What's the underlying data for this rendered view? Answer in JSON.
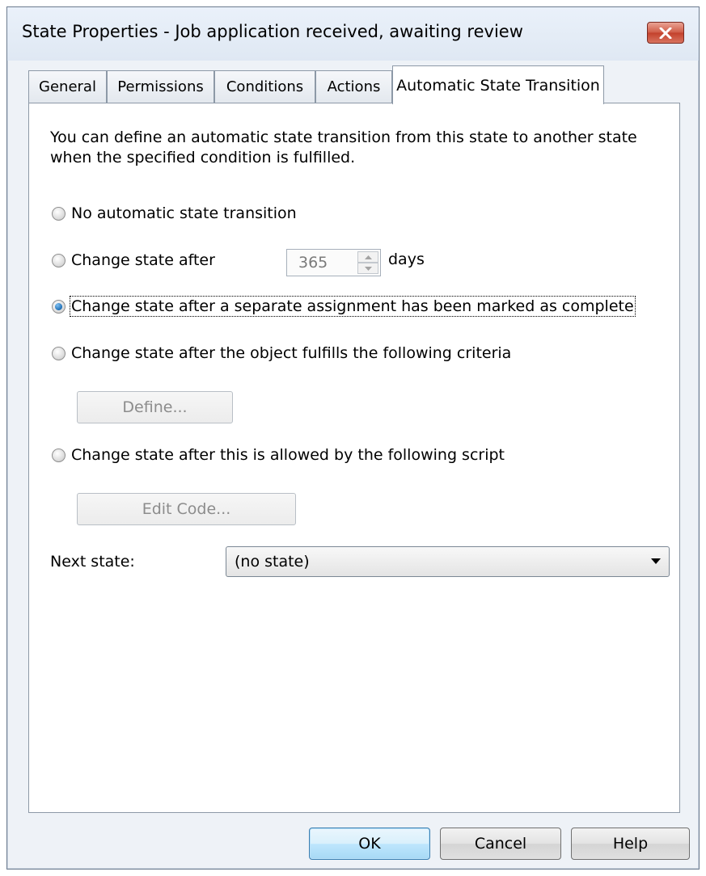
{
  "window": {
    "title": "State Properties - Job application received, awaiting review"
  },
  "tabs": [
    {
      "label": "General"
    },
    {
      "label": "Permissions"
    },
    {
      "label": "Conditions"
    },
    {
      "label": "Actions"
    },
    {
      "label": "Automatic State Transition",
      "active": true
    }
  ],
  "panel": {
    "intro": "You can define an automatic state transition from this state to another state when the specified condition is fulfilled.",
    "options": [
      {
        "label": "No automatic state transition",
        "checked": false
      },
      {
        "label": "Change state after",
        "checked": false
      },
      {
        "label": "Change state after a separate assignment has been marked as complete",
        "checked": true
      },
      {
        "label": "Change state after the object fulfills the following criteria",
        "checked": false
      },
      {
        "label": "Change state after this is allowed by the following script",
        "checked": false
      }
    ],
    "days_value": "365",
    "days_unit": "days",
    "define_button": "Define...",
    "edit_code_button": "Edit Code...",
    "next_state_label": "Next state:",
    "next_state_value": "(no state)"
  },
  "footer": {
    "ok": "OK",
    "cancel": "Cancel",
    "help": "Help"
  },
  "colors": {
    "accent": "#3c7fb1",
    "close": "#c3402b",
    "frame": "#eef2f7"
  },
  "icons": [
    "close-icon",
    "spin-up-icon",
    "spin-down-icon",
    "dropdown-arrow-icon"
  ]
}
